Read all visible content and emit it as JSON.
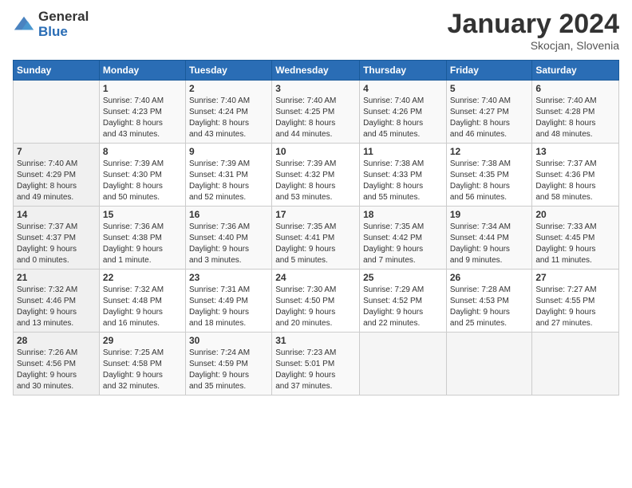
{
  "header": {
    "logo_general": "General",
    "logo_blue": "Blue",
    "month_title": "January 2024",
    "location": "Skocjan, Slovenia"
  },
  "weekdays": [
    "Sunday",
    "Monday",
    "Tuesday",
    "Wednesday",
    "Thursday",
    "Friday",
    "Saturday"
  ],
  "weeks": [
    [
      {
        "day": "",
        "info": ""
      },
      {
        "day": "1",
        "info": "Sunrise: 7:40 AM\nSunset: 4:23 PM\nDaylight: 8 hours\nand 43 minutes."
      },
      {
        "day": "2",
        "info": "Sunrise: 7:40 AM\nSunset: 4:24 PM\nDaylight: 8 hours\nand 43 minutes."
      },
      {
        "day": "3",
        "info": "Sunrise: 7:40 AM\nSunset: 4:25 PM\nDaylight: 8 hours\nand 44 minutes."
      },
      {
        "day": "4",
        "info": "Sunrise: 7:40 AM\nSunset: 4:26 PM\nDaylight: 8 hours\nand 45 minutes."
      },
      {
        "day": "5",
        "info": "Sunrise: 7:40 AM\nSunset: 4:27 PM\nDaylight: 8 hours\nand 46 minutes."
      },
      {
        "day": "6",
        "info": "Sunrise: 7:40 AM\nSunset: 4:28 PM\nDaylight: 8 hours\nand 48 minutes."
      }
    ],
    [
      {
        "day": "7",
        "info": "Sunrise: 7:40 AM\nSunset: 4:29 PM\nDaylight: 8 hours\nand 49 minutes."
      },
      {
        "day": "8",
        "info": "Sunrise: 7:39 AM\nSunset: 4:30 PM\nDaylight: 8 hours\nand 50 minutes."
      },
      {
        "day": "9",
        "info": "Sunrise: 7:39 AM\nSunset: 4:31 PM\nDaylight: 8 hours\nand 52 minutes."
      },
      {
        "day": "10",
        "info": "Sunrise: 7:39 AM\nSunset: 4:32 PM\nDaylight: 8 hours\nand 53 minutes."
      },
      {
        "day": "11",
        "info": "Sunrise: 7:38 AM\nSunset: 4:33 PM\nDaylight: 8 hours\nand 55 minutes."
      },
      {
        "day": "12",
        "info": "Sunrise: 7:38 AM\nSunset: 4:35 PM\nDaylight: 8 hours\nand 56 minutes."
      },
      {
        "day": "13",
        "info": "Sunrise: 7:37 AM\nSunset: 4:36 PM\nDaylight: 8 hours\nand 58 minutes."
      }
    ],
    [
      {
        "day": "14",
        "info": "Sunrise: 7:37 AM\nSunset: 4:37 PM\nDaylight: 9 hours\nand 0 minutes."
      },
      {
        "day": "15",
        "info": "Sunrise: 7:36 AM\nSunset: 4:38 PM\nDaylight: 9 hours\nand 1 minute."
      },
      {
        "day": "16",
        "info": "Sunrise: 7:36 AM\nSunset: 4:40 PM\nDaylight: 9 hours\nand 3 minutes."
      },
      {
        "day": "17",
        "info": "Sunrise: 7:35 AM\nSunset: 4:41 PM\nDaylight: 9 hours\nand 5 minutes."
      },
      {
        "day": "18",
        "info": "Sunrise: 7:35 AM\nSunset: 4:42 PM\nDaylight: 9 hours\nand 7 minutes."
      },
      {
        "day": "19",
        "info": "Sunrise: 7:34 AM\nSunset: 4:44 PM\nDaylight: 9 hours\nand 9 minutes."
      },
      {
        "day": "20",
        "info": "Sunrise: 7:33 AM\nSunset: 4:45 PM\nDaylight: 9 hours\nand 11 minutes."
      }
    ],
    [
      {
        "day": "21",
        "info": "Sunrise: 7:32 AM\nSunset: 4:46 PM\nDaylight: 9 hours\nand 13 minutes."
      },
      {
        "day": "22",
        "info": "Sunrise: 7:32 AM\nSunset: 4:48 PM\nDaylight: 9 hours\nand 16 minutes."
      },
      {
        "day": "23",
        "info": "Sunrise: 7:31 AM\nSunset: 4:49 PM\nDaylight: 9 hours\nand 18 minutes."
      },
      {
        "day": "24",
        "info": "Sunrise: 7:30 AM\nSunset: 4:50 PM\nDaylight: 9 hours\nand 20 minutes."
      },
      {
        "day": "25",
        "info": "Sunrise: 7:29 AM\nSunset: 4:52 PM\nDaylight: 9 hours\nand 22 minutes."
      },
      {
        "day": "26",
        "info": "Sunrise: 7:28 AM\nSunset: 4:53 PM\nDaylight: 9 hours\nand 25 minutes."
      },
      {
        "day": "27",
        "info": "Sunrise: 7:27 AM\nSunset: 4:55 PM\nDaylight: 9 hours\nand 27 minutes."
      }
    ],
    [
      {
        "day": "28",
        "info": "Sunrise: 7:26 AM\nSunset: 4:56 PM\nDaylight: 9 hours\nand 30 minutes."
      },
      {
        "day": "29",
        "info": "Sunrise: 7:25 AM\nSunset: 4:58 PM\nDaylight: 9 hours\nand 32 minutes."
      },
      {
        "day": "30",
        "info": "Sunrise: 7:24 AM\nSunset: 4:59 PM\nDaylight: 9 hours\nand 35 minutes."
      },
      {
        "day": "31",
        "info": "Sunrise: 7:23 AM\nSunset: 5:01 PM\nDaylight: 9 hours\nand 37 minutes."
      },
      {
        "day": "",
        "info": ""
      },
      {
        "day": "",
        "info": ""
      },
      {
        "day": "",
        "info": ""
      }
    ]
  ]
}
